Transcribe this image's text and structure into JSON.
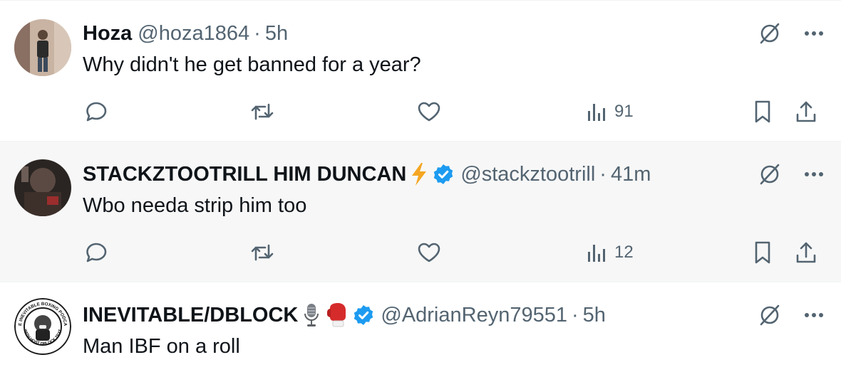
{
  "colors": {
    "text": "#0f1419",
    "secondary": "#536471",
    "verified": "#1d9bf0",
    "hover_bg": "#f7f7f7",
    "divider": "#eff3f4"
  },
  "tweets": [
    {
      "name": "Hoza",
      "handle": "@hoza1864",
      "separator": "·",
      "time": "5h",
      "text": "Why didn't he get banned for a year?",
      "verified": false,
      "views": "91"
    },
    {
      "name": "STACKZTOOTRILL HIM DUNCAN",
      "handle": "@stackztootrill",
      "separator": "·",
      "time": "41m",
      "text": "Wbo needa strip him too",
      "verified": true,
      "emojis": [
        "lightning-emoji"
      ],
      "views": "12"
    },
    {
      "name": "INEVITABLE/DBLOCK",
      "handle": "@AdrianReyn79551",
      "separator": "·",
      "time": "5h",
      "text": "Man IBF on a roll",
      "verified": true,
      "emojis": [
        "microphone-emoji",
        "boxing-glove-emoji"
      ],
      "avatar_text": {
        "top": "THE INEVITABLE BOXING PODCAST",
        "bottom": "WITH HOST DBLOCK TEXT"
      }
    }
  ]
}
